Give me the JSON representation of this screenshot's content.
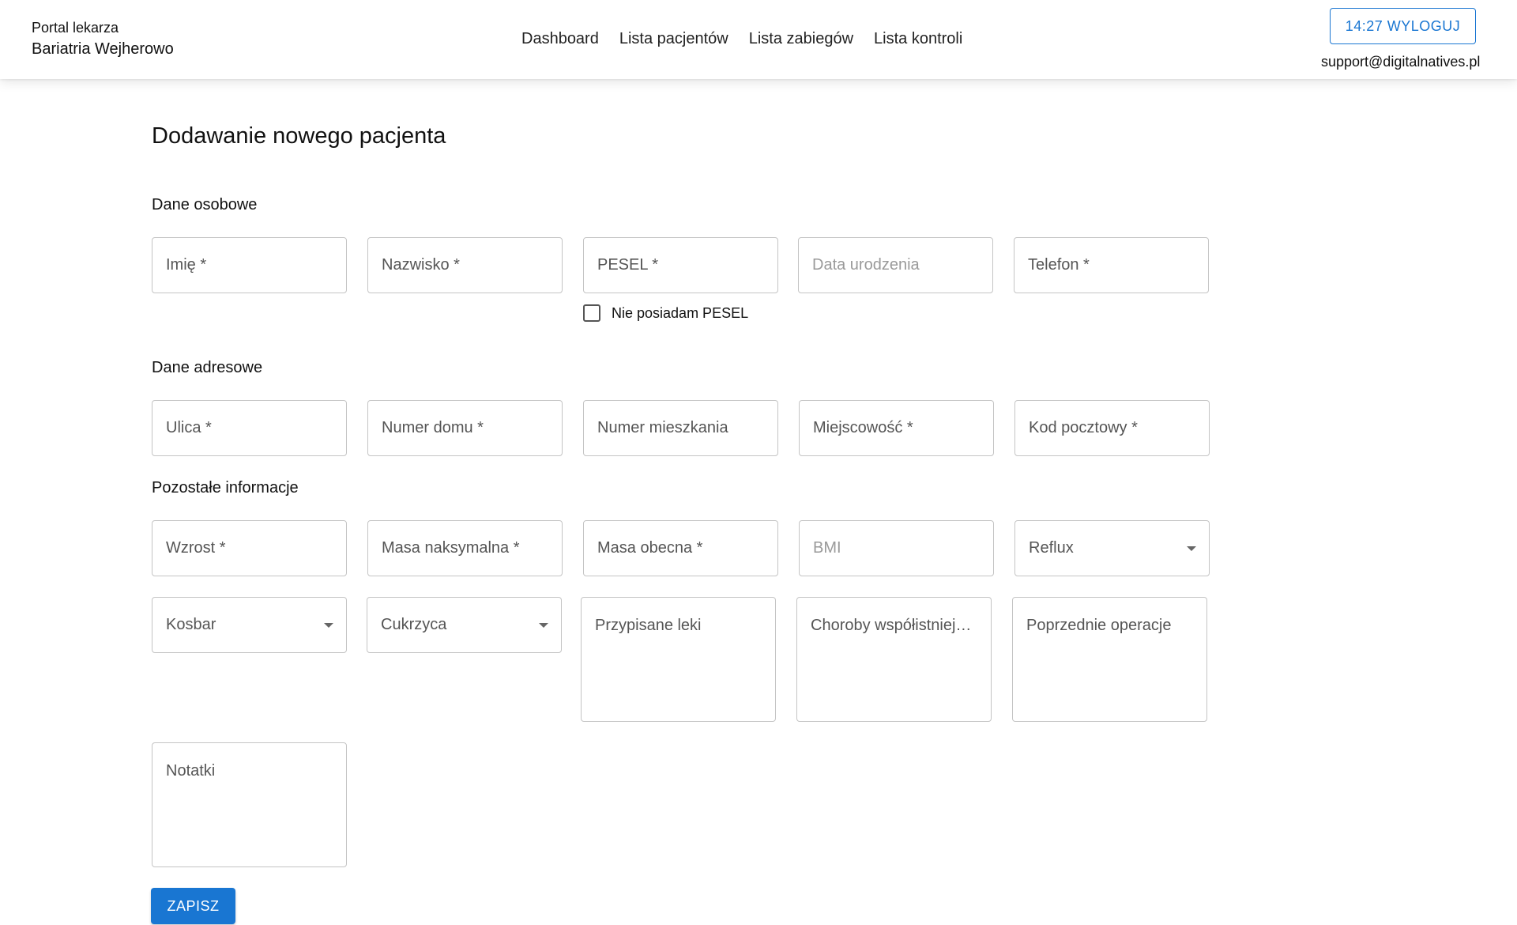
{
  "header": {
    "portal_label": "Portal lekarza",
    "clinic_name": "Bariatria Wejherowo",
    "nav": [
      "Dashboard",
      "Lista pacjentów",
      "Lista zabiegów",
      "Lista kontroli"
    ],
    "logout_label": "14:27 WYLOGUJ",
    "support_email": "support@digitalnatives.pl"
  },
  "page": {
    "title": "Dodawanie nowego pacjenta"
  },
  "sections": {
    "personal": "Dane osobowe",
    "address": "Dane adresowe",
    "other": "Pozostałe informacje"
  },
  "personal_fields": {
    "first_name": "Imię *",
    "last_name": "Nazwisko *",
    "pesel": "PESEL *",
    "birth_date": "Data urodzenia",
    "phone": "Telefon *",
    "no_pesel": "Nie posiadam PESEL"
  },
  "address_fields": {
    "street": "Ulica *",
    "house_number": "Numer domu *",
    "apartment_number": "Numer mieszkania",
    "city": "Miejscowość *",
    "postal_code": "Kod pocztowy *"
  },
  "other_fields": {
    "height": "Wzrost *",
    "max_weight": "Masa naksymalna *",
    "current_weight": "Masa obecna *",
    "bmi": "BMI",
    "reflux": "Reflux",
    "kosbar": "Kosbar",
    "diabetes": "Cukrzyca",
    "medications": "Przypisane leki",
    "comorbidities": "Choroby współistniejące",
    "previous_operations": "Poprzednie operacje",
    "notes": "Notatki"
  },
  "actions": {
    "save": "ZAPISZ"
  }
}
